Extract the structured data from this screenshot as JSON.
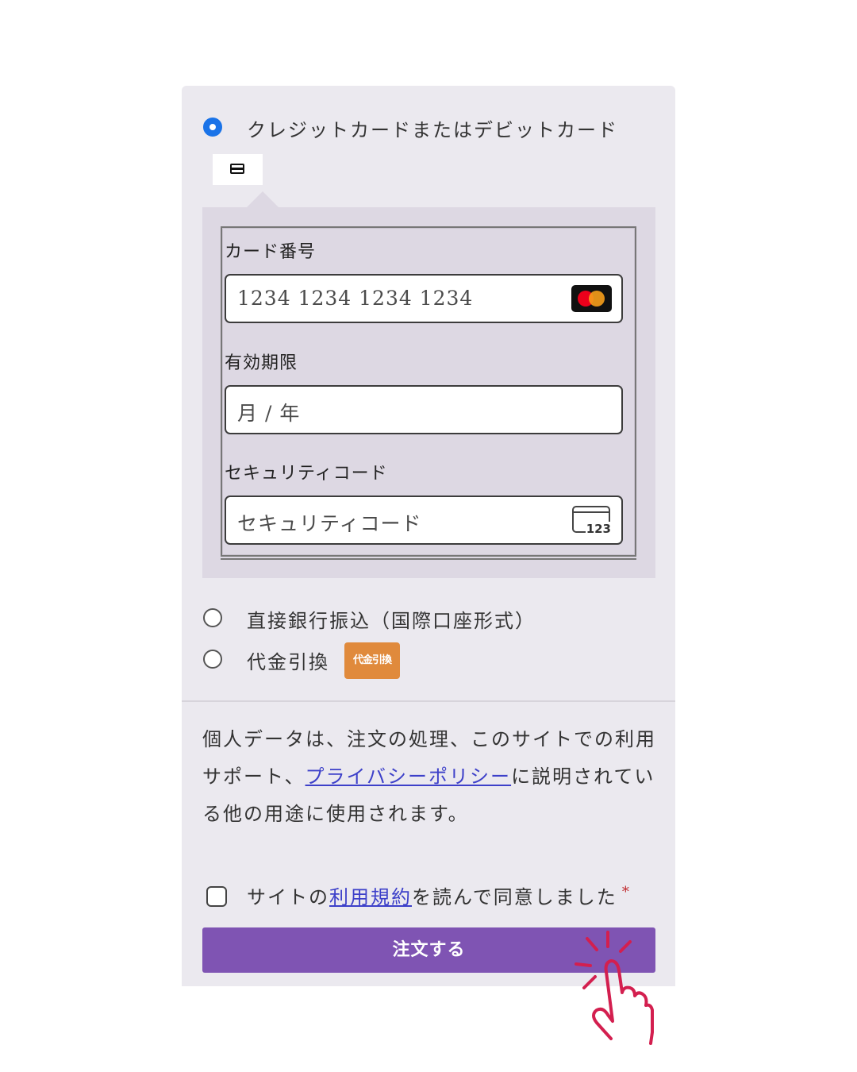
{
  "payment": {
    "card_option_label": "クレジットカードまたはデビットカード",
    "card_tab_icon": "credit-card-icon",
    "card_number_label": "カード番号",
    "card_number_placeholder": "1234 1234 1234 1234",
    "card_brand_icon": "mastercard-icon",
    "expiry_label": "有効期限",
    "expiry_placeholder": "月 / 年",
    "cvc_label": "セキュリティコード",
    "cvc_placeholder": "セキュリティコード",
    "cvc_icon_text": "123",
    "bank_option_label": "直接銀行振込（国際口座形式）",
    "cod_option_label": "代金引換",
    "cod_badge_text": "代金引換"
  },
  "privacy": {
    "text_before": "個人データは、注文の処理、このサイトでの利用サポート、",
    "link_text": "プライバシーポリシー",
    "text_after": "に説明されている他の用途に使用されます。"
  },
  "terms": {
    "text_before": "サイトの",
    "link_text": "利用規約",
    "text_after": "を読んで同意しました",
    "required_mark": "*"
  },
  "submit": {
    "label": "注文する"
  },
  "colors": {
    "accent": "#7f54b3",
    "radio_selected": "#1a73e8",
    "link": "#3d40c9",
    "cod_badge": "#e08a3c",
    "hand_pointer": "#d31f4f"
  }
}
